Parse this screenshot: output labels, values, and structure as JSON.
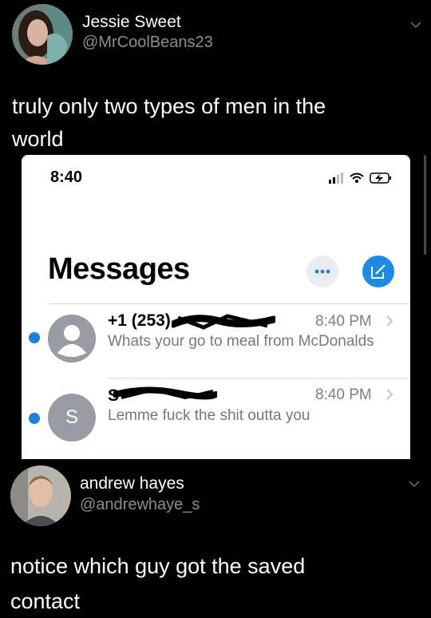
{
  "tweet1": {
    "name": "Jessie Sweet",
    "handle": "@MrCoolBeans23",
    "text_line1": "truly only two types of men in the",
    "text_line2": "world"
  },
  "screenshot": {
    "status_time": "8:40",
    "title": "Messages",
    "conversations": [
      {
        "sender": "+1 (253)",
        "time": "8:40 PM",
        "preview": "Whats your go to meal from McDonalds",
        "unread": true,
        "avatar": "person-silhouette-icon"
      },
      {
        "sender": "S",
        "time": "8:40 PM",
        "preview": "Lemme fuck the shit outta you",
        "unread": true,
        "avatar_initial": "S"
      }
    ]
  },
  "tweet2": {
    "name": "andrew hayes",
    "handle": "@andrewhaye_s",
    "text_line1": "notice which guy got the saved",
    "text_line2": "contact"
  },
  "colors": {
    "background": "#000000",
    "handle_gray": "#8a8d91",
    "ios_blue": "#1e7fe0"
  }
}
